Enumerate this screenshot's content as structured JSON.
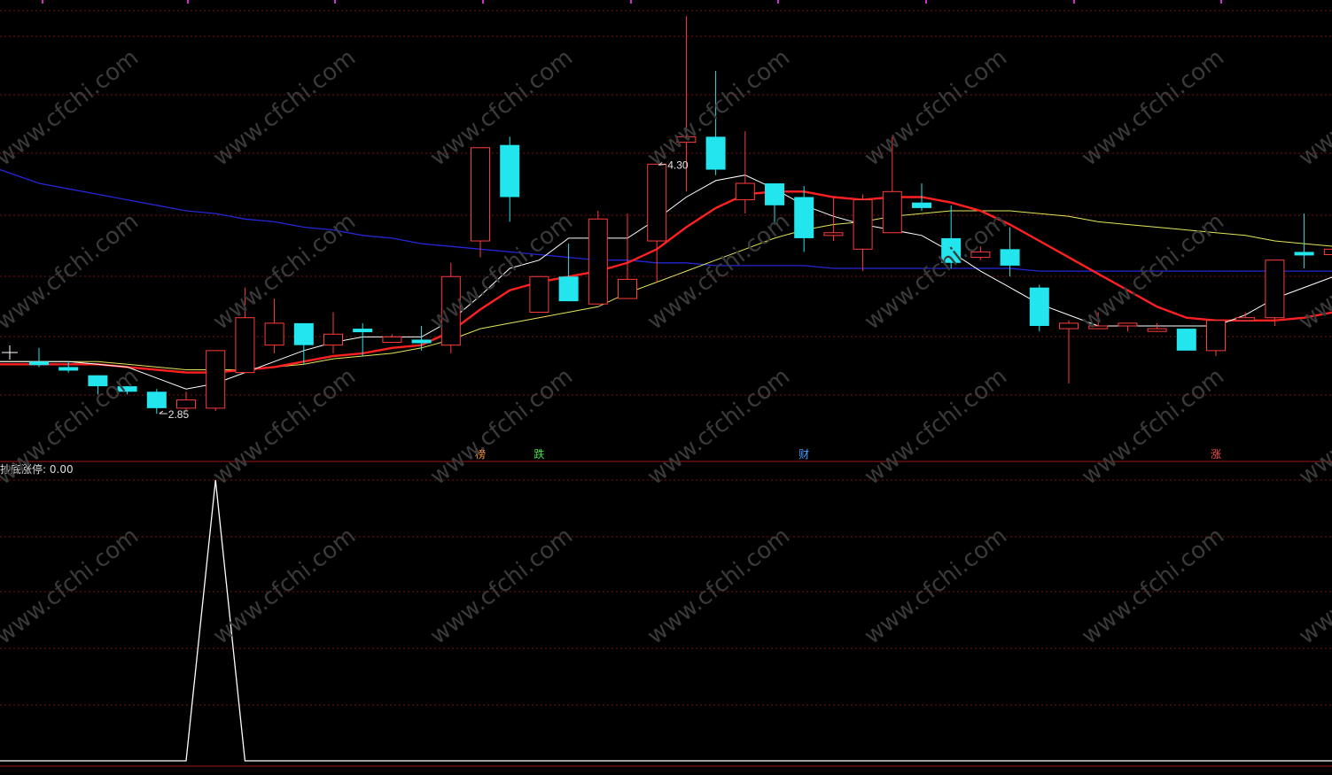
{
  "colors": {
    "up": "#ff3b3b",
    "down": "#22e5ee",
    "grid": "#7a1010",
    "ma_short": "#ffffff",
    "ma_mid": "#ff2020",
    "ma_long_yellow": "#e6e65a",
    "ma_longest_blue": "#2626d8",
    "indicator_line": "#ffffff"
  },
  "watermark": "www.cfchi.com",
  "chart_data": [
    {
      "type": "candlestick",
      "title": "",
      "ylim": [
        2.75,
        4.32
      ],
      "grid": true,
      "annotations": [
        {
          "label": "4.30",
          "candle_index": 21,
          "kind": "high"
        },
        {
          "label": "2.85",
          "candle_index": 4,
          "kind": "low"
        }
      ],
      "candles": [
        {
          "o": 3.04,
          "c": 3.03,
          "h": 3.09,
          "l": 3.02
        },
        {
          "o": 3.02,
          "c": 3.01,
          "h": 3.04,
          "l": 3.0
        },
        {
          "o": 2.99,
          "c": 2.95,
          "h": 2.99,
          "l": 2.92
        },
        {
          "o": 2.95,
          "c": 2.93,
          "h": 2.95,
          "l": 2.92
        },
        {
          "o": 2.93,
          "c": 2.87,
          "h": 2.94,
          "l": 2.85
        },
        {
          "o": 2.87,
          "c": 2.9,
          "h": 2.93,
          "l": 2.86
        },
        {
          "o": 2.87,
          "c": 3.08,
          "h": 3.08,
          "l": 2.86
        },
        {
          "o": 3.0,
          "c": 3.2,
          "h": 3.31,
          "l": 3.0
        },
        {
          "o": 3.1,
          "c": 3.18,
          "h": 3.27,
          "l": 3.07
        },
        {
          "o": 3.18,
          "c": 3.1,
          "h": 3.18,
          "l": 3.03
        },
        {
          "o": 3.1,
          "c": 3.14,
          "h": 3.22,
          "l": 3.07
        },
        {
          "o": 3.16,
          "c": 3.15,
          "h": 3.18,
          "l": 3.06
        },
        {
          "o": 3.11,
          "c": 3.13,
          "h": 3.14,
          "l": 3.11
        },
        {
          "o": 3.12,
          "c": 3.11,
          "h": 3.17,
          "l": 3.08
        },
        {
          "o": 3.1,
          "c": 3.35,
          "h": 3.4,
          "l": 3.07
        },
        {
          "o": 3.48,
          "c": 3.82,
          "h": 3.82,
          "l": 3.42
        },
        {
          "o": 3.83,
          "c": 3.64,
          "h": 3.86,
          "l": 3.55
        },
        {
          "o": 3.22,
          "c": 3.35,
          "h": 3.35,
          "l": 3.23
        },
        {
          "o": 3.35,
          "c": 3.26,
          "h": 3.47,
          "l": 3.26
        },
        {
          "o": 3.25,
          "c": 3.56,
          "h": 3.59,
          "l": 3.25
        },
        {
          "o": 3.27,
          "c": 3.34,
          "h": 3.58,
          "l": 3.27
        },
        {
          "o": 3.48,
          "c": 3.76,
          "h": 3.76,
          "l": 3.33
        },
        {
          "o": 3.84,
          "c": 3.86,
          "h": 4.3,
          "l": 3.66
        },
        {
          "o": 3.86,
          "c": 3.74,
          "h": 4.1,
          "l": 3.72
        },
        {
          "o": 3.63,
          "c": 3.69,
          "h": 3.88,
          "l": 3.58
        },
        {
          "o": 3.69,
          "c": 3.61,
          "h": 3.69,
          "l": 3.54
        },
        {
          "o": 3.64,
          "c": 3.49,
          "h": 3.68,
          "l": 3.44
        },
        {
          "o": 3.5,
          "c": 3.51,
          "h": 3.64,
          "l": 3.48
        },
        {
          "o": 3.45,
          "c": 3.63,
          "h": 3.65,
          "l": 3.37
        },
        {
          "o": 3.51,
          "c": 3.66,
          "h": 3.86,
          "l": 3.51
        },
        {
          "o": 3.62,
          "c": 3.6,
          "h": 3.69,
          "l": 3.59
        },
        {
          "o": 3.49,
          "c": 3.4,
          "h": 3.61,
          "l": 3.38
        },
        {
          "o": 3.42,
          "c": 3.44,
          "h": 3.46,
          "l": 3.41
        },
        {
          "o": 3.45,
          "c": 3.39,
          "h": 3.53,
          "l": 3.35
        },
        {
          "o": 3.31,
          "c": 3.17,
          "h": 3.32,
          "l": 3.15
        },
        {
          "o": 3.16,
          "c": 3.18,
          "h": 3.19,
          "l": 2.96
        },
        {
          "o": 3.16,
          "c": 3.17,
          "h": 3.22,
          "l": 3.16
        },
        {
          "o": 3.17,
          "c": 3.18,
          "h": 3.18,
          "l": 3.15
        },
        {
          "o": 3.15,
          "c": 3.16,
          "h": 3.18,
          "l": 3.15
        },
        {
          "o": 3.16,
          "c": 3.08,
          "h": 3.16,
          "l": 3.08
        },
        {
          "o": 3.08,
          "c": 3.19,
          "h": 3.19,
          "l": 3.06
        },
        {
          "o": 3.19,
          "c": 3.2,
          "h": 3.22,
          "l": 3.19
        },
        {
          "o": 3.2,
          "c": 3.41,
          "h": 3.41,
          "l": 3.17
        },
        {
          "o": 3.44,
          "c": 3.43,
          "h": 3.58,
          "l": 3.38
        },
        {
          "o": 3.43,
          "c": 3.45,
          "h": 3.52,
          "l": 3.43
        }
      ],
      "series": [
        {
          "key": "ma_short",
          "values": [
            3.04,
            3.04,
            3.03,
            3.02,
            2.98,
            2.94,
            2.96,
            3.0,
            3.04,
            3.08,
            3.11,
            3.13,
            3.13,
            3.13,
            3.19,
            3.28,
            3.38,
            3.41,
            3.49,
            3.49,
            3.49,
            3.56,
            3.64,
            3.7,
            3.72,
            3.67,
            3.61,
            3.57,
            3.54,
            3.52,
            3.5,
            3.44,
            3.37,
            3.31,
            3.25,
            3.21,
            3.17,
            3.17,
            3.17,
            3.17,
            3.17,
            3.21,
            3.27,
            3.31,
            3.35
          ]
        },
        {
          "key": "ma_mid",
          "values": [
            3.03,
            3.03,
            3.03,
            3.02,
            3.01,
            3.0,
            3.0,
            3.01,
            3.02,
            3.04,
            3.06,
            3.07,
            3.09,
            3.1,
            3.15,
            3.23,
            3.3,
            3.33,
            3.35,
            3.37,
            3.4,
            3.45,
            3.53,
            3.6,
            3.65,
            3.66,
            3.66,
            3.64,
            3.63,
            3.64,
            3.64,
            3.62,
            3.59,
            3.54,
            3.48,
            3.42,
            3.36,
            3.3,
            3.24,
            3.2,
            3.19,
            3.19,
            3.19,
            3.2,
            3.22
          ]
        },
        {
          "key": "ma_long_yellow",
          "values": [
            3.04,
            3.04,
            3.04,
            3.03,
            3.02,
            3.01,
            3.01,
            3.01,
            3.02,
            3.03,
            3.05,
            3.06,
            3.07,
            3.09,
            3.12,
            3.16,
            3.18,
            3.2,
            3.22,
            3.24,
            3.29,
            3.33,
            3.37,
            3.41,
            3.45,
            3.49,
            3.52,
            3.54,
            3.55,
            3.57,
            3.58,
            3.59,
            3.59,
            3.59,
            3.58,
            3.57,
            3.55,
            3.54,
            3.53,
            3.52,
            3.51,
            3.5,
            3.48,
            3.47,
            3.46
          ]
        },
        {
          "key": "ma_longest_blue",
          "values": [
            3.69,
            3.67,
            3.65,
            3.63,
            3.61,
            3.59,
            3.58,
            3.56,
            3.55,
            3.53,
            3.52,
            3.5,
            3.49,
            3.47,
            3.46,
            3.45,
            3.44,
            3.43,
            3.42,
            3.41,
            3.41,
            3.4,
            3.4,
            3.39,
            3.39,
            3.39,
            3.39,
            3.38,
            3.38,
            3.38,
            3.38,
            3.38,
            3.38,
            3.38,
            3.37,
            3.37,
            3.37,
            3.37,
            3.37,
            3.37,
            3.37,
            3.37,
            3.37,
            3.37,
            3.37
          ]
        }
      ],
      "markers": [
        {
          "label": "榜",
          "candle_index": 15,
          "color": "#ff9a3c"
        },
        {
          "label": "跌",
          "candle_index": 17,
          "color": "#43e043"
        },
        {
          "label": "财",
          "candle_index": 26,
          "color": "#4aa0ff"
        },
        {
          "label": "涨",
          "candle_index": 40,
          "color": "#ff4a4a"
        }
      ]
    },
    {
      "type": "line",
      "title": "",
      "label": "抄底涨停:",
      "current_value": "0.00",
      "ylim": [
        0,
        1
      ],
      "values": [
        0,
        0,
        0,
        0,
        0,
        0,
        1,
        0,
        0,
        0,
        0,
        0,
        0,
        0,
        0,
        0,
        0,
        0,
        0,
        0,
        0,
        0,
        0,
        0,
        0,
        0,
        0,
        0,
        0,
        0,
        0,
        0,
        0,
        0,
        0,
        0,
        0,
        0,
        0,
        0,
        0,
        0,
        0,
        0,
        0
      ]
    }
  ]
}
